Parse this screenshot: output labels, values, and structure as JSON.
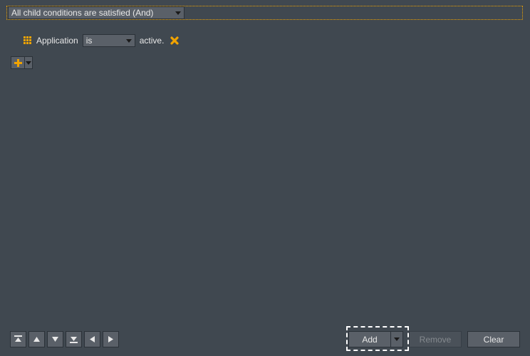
{
  "group": {
    "label": "All child conditions are satisfied (And)"
  },
  "condition": {
    "prefix": "Application",
    "op": "is",
    "suffix": "active."
  },
  "buttons": {
    "add": "Add",
    "remove": "Remove",
    "clear": "Clear"
  }
}
